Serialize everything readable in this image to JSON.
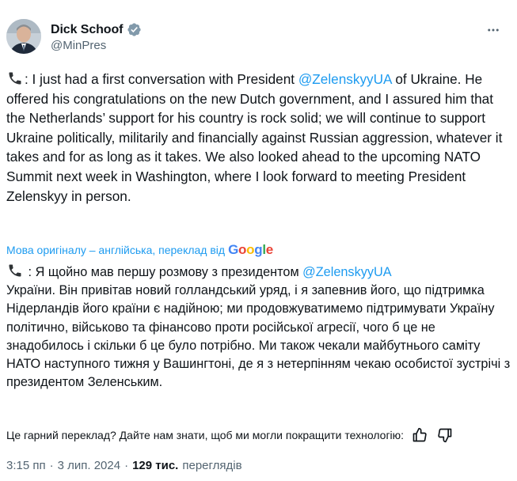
{
  "author": {
    "display_name": "Dick Schoof",
    "handle": "@MinPres",
    "verified": true
  },
  "tweet": {
    "text_before_mention": ": I just had a first conversation with President ",
    "mention": "@ZelenskyyUA",
    "text_after_mention": " of Ukraine. He offered his congratulations on the new Dutch government, and I assured him that the Netherlands’ support for his country is rock solid; we will continue to support Ukraine politically, militarily and financially against Russian aggression, whatever it takes and for as long as it takes. We also looked ahead to the upcoming NATO Summit next week in Washington, where I look forward to meeting President Zelenskyy in person."
  },
  "translation": {
    "source_note": "Мова оригіналу – англійська, переклад від",
    "provider": "Google",
    "text_before_mention": " : Я щойно мав першу розмову з президентом ",
    "mention": "@ZelenskyyUA",
    "text_after_mention": "\nУкраїни. Він привітав новий голландський уряд, і я запевнив його, що підтримка Нідерландів його країни є надійною; ми продовжуватимемо підтримувати Україну політично, військово та фінансово проти російської агресії, чого б це не знадобилось і скільки б це було потрібно. Ми також чекали майбутнього саміту НАТО наступного тижня у Вашингтоні, де я з нетерпінням чекаю особистої зустрічі з президентом Зеленським."
  },
  "feedback": {
    "prompt": "Це гарний переклад? Дайте нам знати, щоб ми могли покращити технологію:"
  },
  "meta": {
    "time": "3:15 пп",
    "separator": "·",
    "date": "3 лип. 2024",
    "views_count": "129 тис.",
    "views_label": "переглядів"
  },
  "colors": {
    "link": "#1d9bf0",
    "text": "#0f1419",
    "secondary": "#536471"
  }
}
